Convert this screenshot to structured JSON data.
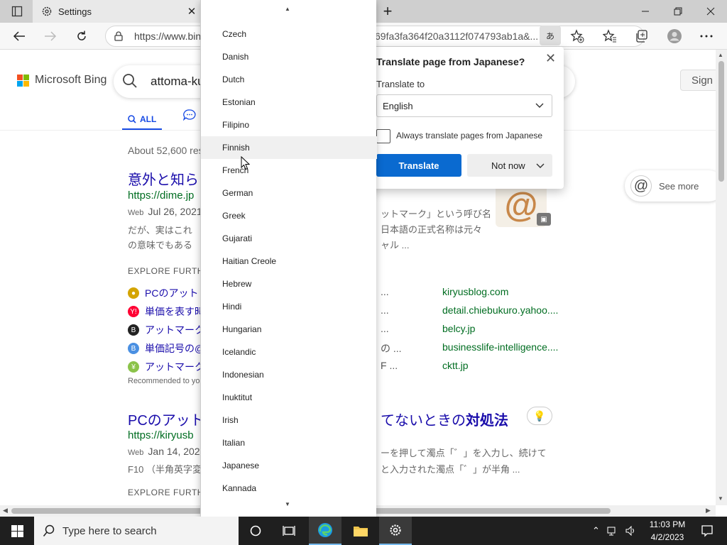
{
  "browser": {
    "tab_title": "Settings",
    "tab_close": "✕",
    "new_tab": "+",
    "url_visible": "https://www.bin",
    "url_tail": "69fa3fa364f20a3112f074793ab1a&...",
    "translate_indicator": "あ"
  },
  "bing": {
    "logo_text": "Microsoft Bing",
    "query": "attoma-ku",
    "sign_in": "Sign i",
    "scope_all": "ALL",
    "results_count": "About 52,600 res",
    "result1": {
      "title": "意外と知ら",
      "url": "https://dime.jp",
      "web": "Web",
      "date": "Jul 26, 2021",
      "snippet_left": [
        "だが、実はこれ",
        "の意味でもある"
      ],
      "snippet_right": [
        "ットマーク」という呼び名",
        "日本語の正式名称は元々",
        "ャル ..."
      ]
    },
    "explore_label": "EXPLORE FURTHE",
    "explore": [
      {
        "text": "PCのアット",
        "domain": "kiryusblog.com",
        "icon": "pc-icon",
        "color": "#d4a400",
        "glyph": "●"
      },
      {
        "text": "単価を表す時",
        "domain": "detail.chiebukuro.yahoo....",
        "icon": "yahoo-icon",
        "color": "#ff0033",
        "glyph": "Y!"
      },
      {
        "text": "アットマーク",
        "domain": "belcy.jp",
        "icon": "b-icon",
        "color": "#222222",
        "glyph": "B"
      },
      {
        "text": "単価記号の@",
        "domain": "businesslife-intelligence....",
        "icon": "b-blue-icon",
        "color": "#4a90e2",
        "glyph": "B"
      },
      {
        "text": "アットマーク",
        "domain": "cktt.jp",
        "icon": "yen-icon",
        "color": "#8bc34a",
        "glyph": "¥"
      }
    ],
    "explore_dots": [
      "...",
      "...",
      "...",
      "の ...",
      "F ..."
    ],
    "recommended": "Recommended to yo",
    "result2": {
      "title_left": "PCのアット",
      "title_right": "てないときの",
      "title_bold": "対処法",
      "url": "https://kiryusb",
      "web": "Web",
      "date": "Jan 14, 202",
      "snippet_left": "F10 （半角英字変",
      "snippet_right": [
        "ーを押して濁点「゛」を入力し、続けて",
        "と入力された濁点「゛」が半角 ..."
      ]
    },
    "explore_label2": "EXPLORE FURTHE",
    "see_more": "See more"
  },
  "translate_popup": {
    "title": "Translate page from Japanese?",
    "translate_to_label": "Translate to",
    "selected_language": "English",
    "always_translate": "Always translate pages from Japanese",
    "always_checked": false,
    "translate_button": "Translate",
    "not_now_button": "Not now",
    "accent_color": "#0a6ad0"
  },
  "language_list": {
    "items": [
      "Czech",
      "Danish",
      "Dutch",
      "Estonian",
      "Filipino",
      "Finnish",
      "French",
      "German",
      "Greek",
      "Gujarati",
      "Haitian Creole",
      "Hebrew",
      "Hindi",
      "Hungarian",
      "Icelandic",
      "Indonesian",
      "Inuktitut",
      "Irish",
      "Italian",
      "Japanese",
      "Kannada"
    ],
    "hovered": "Finnish"
  },
  "taskbar": {
    "search_placeholder": "Type here to search",
    "time": "11:03 PM",
    "date": "4/2/2023"
  }
}
